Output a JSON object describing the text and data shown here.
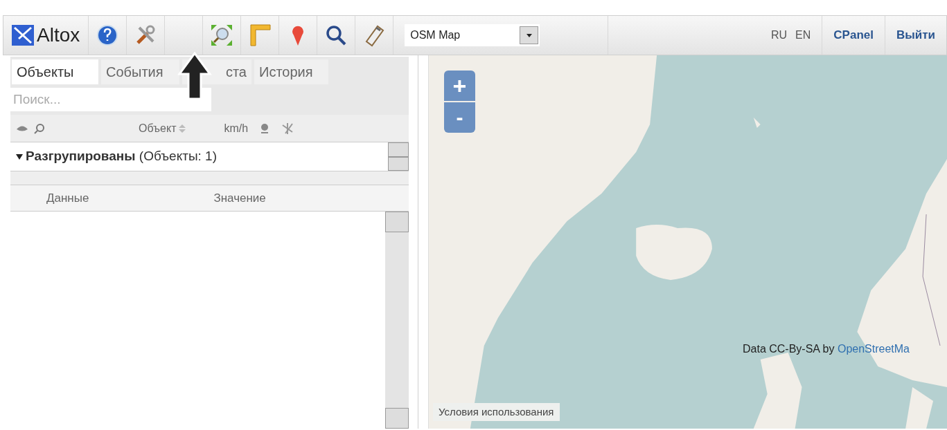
{
  "toolbar": {
    "logo": "Altox",
    "map_select": {
      "value": "OSM Map"
    },
    "languages": [
      {
        "label": "RU",
        "selected": false
      },
      {
        "label": "EN",
        "selected": false
      }
    ],
    "links": [
      "CPanel",
      "Выйти"
    ]
  },
  "left_panel": {
    "tabs": [
      {
        "label": "Объекты",
        "selected": true
      },
      {
        "label": "События",
        "selected": false
      },
      {
        "label": "ста",
        "selected": false
      },
      {
        "label": "История",
        "selected": false
      }
    ],
    "search": {
      "placeholder": "Поиск..."
    },
    "list_header": {
      "object_column": "Объект",
      "speed_column": "km/h"
    },
    "group": {
      "title": "**Разгрупированы** (Объекты: 1)",
      "expanded": true
    },
    "details": {
      "columns": [
        "Данные",
        "Значение"
      ]
    }
  },
  "map": {
    "zoom_in": "+",
    "zoom_out": "-",
    "attribution": "Data CC-By-SA by ",
    "attribution_link": "OpenStreetMa",
    "terms": "Условия использования"
  }
}
